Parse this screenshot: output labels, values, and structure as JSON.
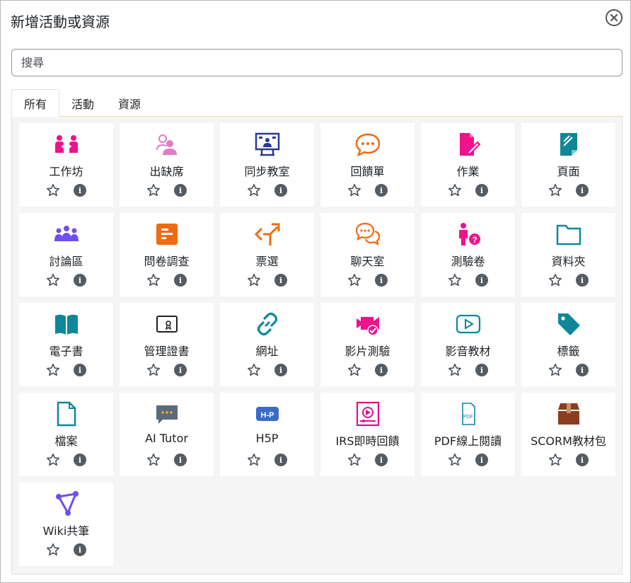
{
  "modal": {
    "title": "新增活動或資源",
    "close_icon": "close-icon"
  },
  "search": {
    "placeholder": "搜尋",
    "value": ""
  },
  "tabs": [
    {
      "label": "所有",
      "active": true
    },
    {
      "label": "活動",
      "active": false
    },
    {
      "label": "資源",
      "active": false
    }
  ],
  "colors": {
    "pink": "#f0118b",
    "navy": "#2b3990",
    "orange": "#f06a12",
    "teal": "#0e8798",
    "purple": "#6f4ef2",
    "blue": "#3a6bc8",
    "brown": "#8a3d1f",
    "slate": "#5a6b7b"
  },
  "items": [
    {
      "label": "工作坊",
      "icon": "workshop-icon"
    },
    {
      "label": "出缺席",
      "icon": "attendance-icon"
    },
    {
      "label": "同步教室",
      "icon": "virtual-classroom-icon"
    },
    {
      "label": "回饋單",
      "icon": "feedback-icon"
    },
    {
      "label": "作業",
      "icon": "assignment-icon"
    },
    {
      "label": "頁面",
      "icon": "page-icon"
    },
    {
      "label": "討論區",
      "icon": "forum-icon"
    },
    {
      "label": "問卷調查",
      "icon": "survey-icon"
    },
    {
      "label": "票選",
      "icon": "choice-icon"
    },
    {
      "label": "聊天室",
      "icon": "chat-icon"
    },
    {
      "label": "測驗卷",
      "icon": "quiz-icon"
    },
    {
      "label": "資料夾",
      "icon": "folder-icon"
    },
    {
      "label": "電子書",
      "icon": "book-icon"
    },
    {
      "label": "管理證書",
      "icon": "certificate-icon"
    },
    {
      "label": "網址",
      "icon": "link-icon"
    },
    {
      "label": "影片測驗",
      "icon": "video-quiz-icon"
    },
    {
      "label": "影音教材",
      "icon": "video-icon"
    },
    {
      "label": "標籤",
      "icon": "tag-icon"
    },
    {
      "label": "檔案",
      "icon": "file-icon"
    },
    {
      "label": "AI Tutor",
      "icon": "ai-tutor-icon"
    },
    {
      "label": "H5P",
      "icon": "h5p-icon"
    },
    {
      "label": "IRS即時回饋",
      "icon": "irs-icon"
    },
    {
      "label": "PDF線上閱讀",
      "icon": "pdf-icon"
    },
    {
      "label": "SCORM教材包",
      "icon": "scorm-icon"
    },
    {
      "label": "Wiki共筆",
      "icon": "wiki-icon"
    }
  ],
  "star_icon": "star-icon",
  "info_icon": "info-icon",
  "info_glyph": "i"
}
